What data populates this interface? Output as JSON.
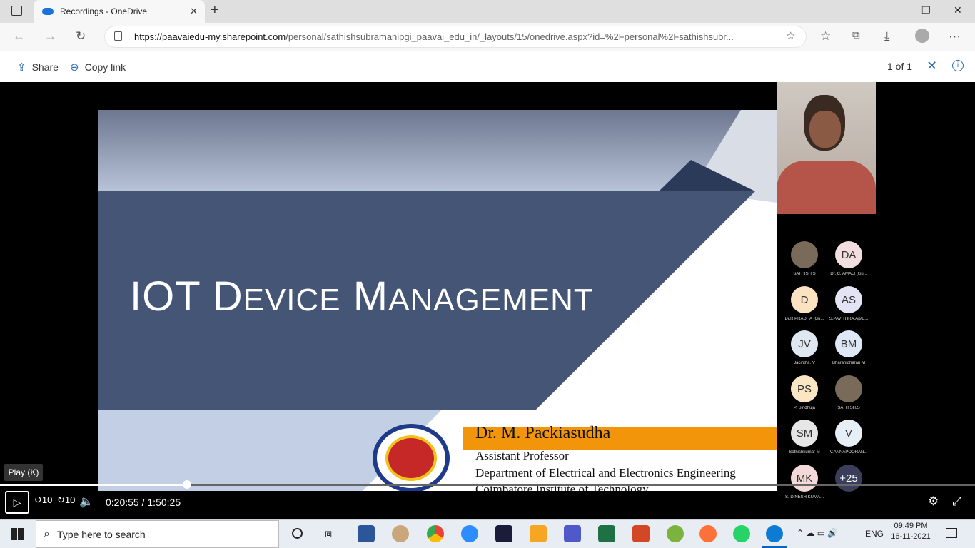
{
  "browser": {
    "tab_title": "Recordings - OneDrive",
    "url_host": "https://paavaiedu-my.sharepoint.com",
    "url_rest": "/personal/sathishsubramanipgi_paavai_edu_in/_layouts/15/onedrive.aspx?id=%2Fpersonal%2Fsathishsubr...",
    "new_tab": "+",
    "win_min": "—",
    "win_max": "❐",
    "win_close": "✕"
  },
  "commandbar": {
    "share_label": "Share",
    "copylink_label": "Copy link",
    "counter": "1 of 1"
  },
  "slide": {
    "title_cap1": "IOT D",
    "title_sm1": "EVICE",
    "title_cap2": " M",
    "title_sm2": "ANAGEMENT",
    "presenter": "Dr. M. Packiasudha",
    "role": "Assistant Professor",
    "dept": "Department of Electrical and Electronics Engineering",
    "inst": "Coimbatore Institute of Technology"
  },
  "participants": [
    {
      "initials": "",
      "name": "SATHISH.S",
      "photo": true,
      "color": "#7a6a5a"
    },
    {
      "initials": "DA",
      "name": "Dr. C. AMALI (Gu...",
      "color": "#f2dede"
    },
    {
      "initials": "D",
      "name": "Dr.R.PRADHA (Gu...",
      "color": "#fbe3c2"
    },
    {
      "initials": "AS",
      "name": "S.PAVITHRA.Ap/E...",
      "color": "#e3e3f5"
    },
    {
      "initials": "JV",
      "name": "Jacintha. V",
      "color": "#dfe8f0"
    },
    {
      "initials": "BM",
      "name": "Bharanidharan M",
      "color": "#dde7f5"
    },
    {
      "initials": "PS",
      "name": "P. Sindhuja",
      "color": "#fbe6c4"
    },
    {
      "initials": "",
      "name": "SATHISH.S",
      "photo": true,
      "color": "#7a6a5a"
    },
    {
      "initials": "SM",
      "name": "Sathishkumar M",
      "color": "#e6e6e6"
    },
    {
      "initials": "V",
      "name": "V.ANNAPOORAN...",
      "color": "#e6eef6"
    },
    {
      "initials": "MK",
      "name": "S. DINESH KUMA...",
      "color": "#f3d9d9"
    },
    {
      "initials": "+25",
      "name": "",
      "color": "#3a3e5a"
    }
  ],
  "player": {
    "tooltip": "Play (K)",
    "current_time": "0:20:55",
    "separator": "/",
    "total_time": "1:50:25",
    "progress_fraction": 0.192
  },
  "taskbar": {
    "search_placeholder": "Type here to search",
    "lang": "ENG",
    "time": "09:49 PM",
    "date": "16-11-2021"
  }
}
